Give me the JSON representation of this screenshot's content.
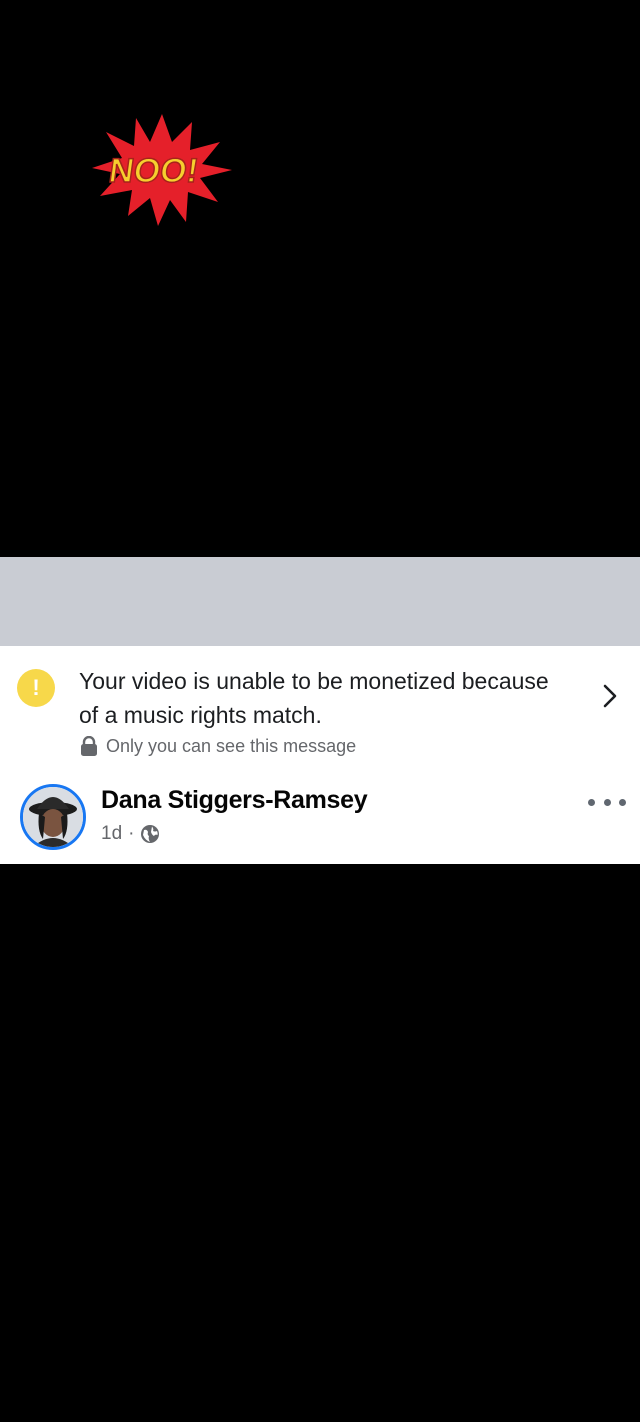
{
  "sticker": {
    "text": "NOO!",
    "colors": {
      "burst": "#e5202a",
      "text": "#f6cf2e",
      "outline": "#c0392b"
    }
  },
  "notice": {
    "icon": "warning-icon",
    "message": "Your video is unable to be monetized because of a music rights match.",
    "privacy_icon": "lock-icon",
    "privacy_text": "Only you can see this message",
    "action_icon": "chevron-right-icon"
  },
  "post": {
    "author_name": "Dana Stiggers-Ramsey",
    "time": "1d",
    "separator": "·",
    "audience_icon": "globe-icon",
    "more_icon": "more-dots-icon"
  },
  "colors": {
    "background": "#000000",
    "band": "#c9ccd3",
    "card": "#ffffff",
    "warning": "#f7d84a",
    "avatar_ring": "#1877f2",
    "secondary_text": "#65676b"
  }
}
